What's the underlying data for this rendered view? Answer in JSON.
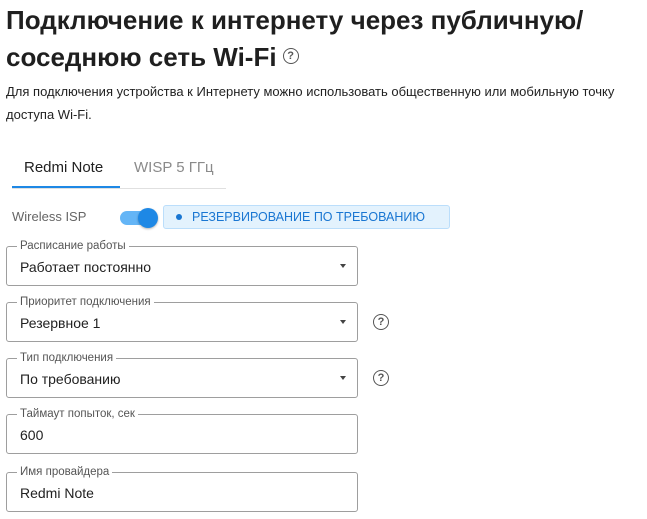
{
  "header": {
    "title": "Подключение к интернету через публичную/ соседнюю сеть Wi-Fi",
    "help_icon": "?"
  },
  "description": "Для подключения устройства к Интернету можно использовать общественную или мобильную точку доступа Wi-Fi.",
  "tabs": [
    {
      "label": "Redmi Note",
      "active": true
    },
    {
      "label": "WISP 5 ГГц",
      "active": false
    }
  ],
  "wisp": {
    "label": "Wireless ISP",
    "enabled": true,
    "status": "РЕЗЕРВИРОВАНИЕ ПО ТРЕБОВАНИЮ"
  },
  "form": {
    "schedule": {
      "label": "Расписание работы",
      "value": "Работает постоянно"
    },
    "priority": {
      "label": "Приоритет подключения",
      "value": "Резервное 1"
    },
    "conn_type": {
      "label": "Тип подключения",
      "value": "По требованию"
    },
    "timeout": {
      "label": "Таймаут попыток, сек",
      "value": "600"
    },
    "provider": {
      "label": "Имя провайдера",
      "value": "Redmi Note"
    }
  },
  "help_glyph": "?",
  "colors": {
    "accent": "#1e88e5",
    "chip_bg": "#e3f2fd",
    "chip_text": "#1976d2"
  }
}
